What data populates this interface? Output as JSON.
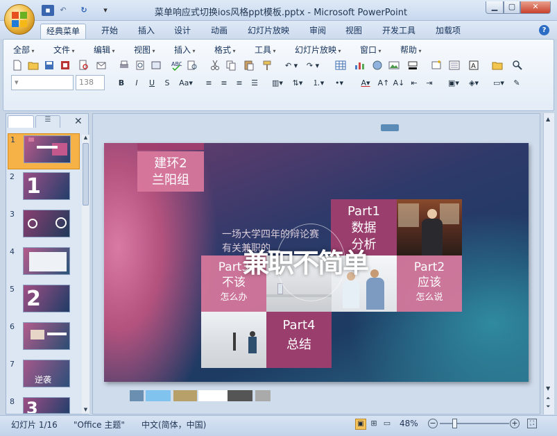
{
  "window": {
    "title": "菜单响应式切换ios风格ppt模板.pptx - Microsoft PowerPoint",
    "minimize": "▁",
    "maximize": "▢",
    "close": "✕"
  },
  "tabs": [
    "经典菜单",
    "开始",
    "插入",
    "设计",
    "动画",
    "幻灯片放映",
    "审阅",
    "视图",
    "开发工具",
    "加载项"
  ],
  "menus": [
    "全部",
    "文件",
    "编辑",
    "视图",
    "插入",
    "格式",
    "工具",
    "幻灯片放映",
    "窗口",
    "帮助"
  ],
  "font_size": "138",
  "thumbnails": [
    {
      "num": "1",
      "label": ""
    },
    {
      "num": "2",
      "label": "1"
    },
    {
      "num": "3",
      "label": ""
    },
    {
      "num": "4",
      "label": ""
    },
    {
      "num": "5",
      "label": "2"
    },
    {
      "num": "6",
      "label": ""
    },
    {
      "num": "7",
      "label": "逆袭"
    },
    {
      "num": "8",
      "label": "3"
    }
  ],
  "slide": {
    "group_line1": "建环2",
    "group_line2": "兰阳组",
    "subtitle_line1": "一场大学四年的辩论赛",
    "subtitle_line2": "有关兼职的",
    "headline": "兼职不简单",
    "part1": {
      "title": "Part1",
      "line1": "数据",
      "line2": "分析"
    },
    "part2": {
      "title": "Part2",
      "line1": "应该",
      "line2": "怎么说"
    },
    "part3": {
      "title": "Part3",
      "line1": "不该",
      "line2": "怎么办"
    },
    "part4": {
      "title": "Part4",
      "line1": "总结"
    }
  },
  "palette": [
    "#6a8fb0",
    "#7fc3ee",
    "#b7a06a",
    "#ffffff",
    "#555555",
    "#aaaaaa"
  ],
  "status": {
    "slide": "幻灯片 1/16",
    "theme": "\"Office 主题\"",
    "language": "中文(简体，中国)",
    "zoom": "48%"
  }
}
